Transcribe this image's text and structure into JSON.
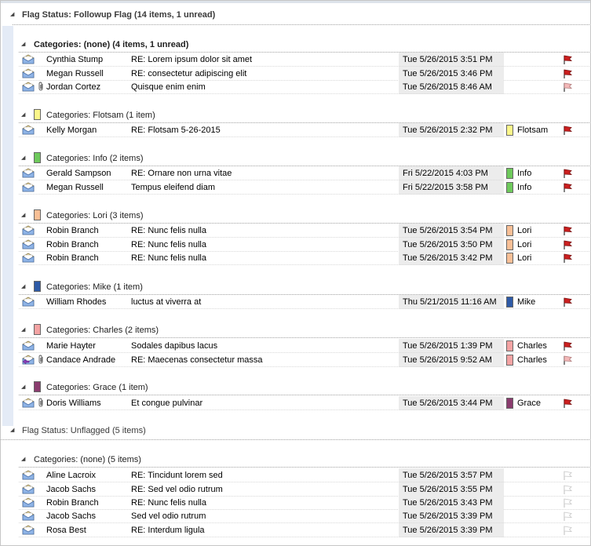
{
  "colors": {
    "Flotsam": "#fbf68a",
    "Info": "#6ec95c",
    "Lori": "#f8bf96",
    "Mike": "#2e5aa6",
    "Charles": "#f4a3a3",
    "Grace": "#8a3c6e",
    "flag_red": "#cc1f1f",
    "flag_pale": "#f3b8b8",
    "flag_empty": "#c7c7c7"
  },
  "groups": {
    "followup": {
      "label": "Flag Status: Followup Flag (14 items, 1 unread)"
    },
    "unflagged": {
      "label": "Flag Status: Unflagged (5 items)"
    }
  },
  "cat_headers": {
    "none1": "Categories: (none) (4 items, 1 unread)",
    "flotsam": "Categories: Flotsam (1 item)",
    "info": "Categories: Info (2 items)",
    "lori": "Categories: Lori (3 items)",
    "mike": "Categories: Mike (1 item)",
    "charles": "Categories: Charles (2 items)",
    "grace": "Categories: Grace (1 item)",
    "none2": "Categories: (none) (5 items)"
  },
  "messages": [
    {
      "from": "Cynthia Stump",
      "subject": "RE: Lorem ipsum dolor sit amet",
      "date": "Tue 5/26/2015 3:51 PM",
      "category": "",
      "unread": true,
      "attach": false,
      "icon": "open",
      "flag": "red"
    },
    {
      "from": "Megan Russell",
      "subject": "RE: consectetur adipiscing elit",
      "date": "Tue 5/26/2015 3:46 PM",
      "category": "",
      "unread": false,
      "attach": false,
      "icon": "open",
      "flag": "red"
    },
    {
      "from": "Jordan Cortez",
      "subject": "Quisque enim enim",
      "date": "Tue 5/26/2015 8:46 AM",
      "category": "",
      "unread": false,
      "attach": true,
      "icon": "open",
      "flag": "pale"
    },
    {
      "from": "Kelly Morgan",
      "subject": "RE: Flotsam 5-26-2015",
      "date": "Tue 5/26/2015 2:32 PM",
      "category": "Flotsam",
      "unread": false,
      "attach": false,
      "icon": "open",
      "flag": "red"
    },
    {
      "from": "Gerald Sampson",
      "subject": "RE: Ornare non urna vitae",
      "date": "Fri 5/22/2015 4:03 PM",
      "category": "Info",
      "unread": false,
      "attach": false,
      "icon": "open",
      "flag": "red"
    },
    {
      "from": "Megan Russell",
      "subject": "Tempus eleifend diam",
      "date": "Fri 5/22/2015 3:58 PM",
      "category": "Info",
      "unread": false,
      "attach": false,
      "icon": "open",
      "flag": "red"
    },
    {
      "from": "Robin Branch",
      "subject": "RE: Nunc felis nulla",
      "date": "Tue 5/26/2015 3:54 PM",
      "category": "Lori",
      "unread": false,
      "attach": false,
      "icon": "open",
      "flag": "red"
    },
    {
      "from": "Robin Branch",
      "subject": "RE: Nunc felis nulla",
      "date": "Tue 5/26/2015 3:50 PM",
      "category": "Lori",
      "unread": false,
      "attach": false,
      "icon": "open",
      "flag": "red"
    },
    {
      "from": "Robin Branch",
      "subject": "RE: Nunc felis nulla",
      "date": "Tue 5/26/2015 3:42 PM",
      "category": "Lori",
      "unread": false,
      "attach": false,
      "icon": "open",
      "flag": "red"
    },
    {
      "from": "William Rhodes",
      "subject": "luctus at viverra at",
      "date": "Thu 5/21/2015 11:16 AM",
      "category": "Mike",
      "unread": false,
      "attach": false,
      "icon": "open",
      "flag": "red"
    },
    {
      "from": "Marie Hayter",
      "subject": "Sodales dapibus lacus",
      "date": "Tue 5/26/2015 1:39 PM",
      "category": "Charles",
      "unread": false,
      "attach": false,
      "icon": "open",
      "flag": "red"
    },
    {
      "from": "Candace Andrade",
      "subject": "RE: Maecenas consectetur massa",
      "date": "Tue 5/26/2015 9:52 AM",
      "category": "Charles",
      "unread": false,
      "attach": true,
      "icon": "replied",
      "flag": "pale"
    },
    {
      "from": "Doris Williams",
      "subject": "Et congue pulvinar",
      "date": "Tue 5/26/2015 3:44 PM",
      "category": "Grace",
      "unread": false,
      "attach": true,
      "icon": "open",
      "flag": "red"
    },
    {
      "from": "Aline Lacroix",
      "subject": "RE: Tincidunt lorem sed",
      "date": "Tue 5/26/2015 3:57 PM",
      "category": "",
      "unread": false,
      "attach": false,
      "icon": "open",
      "flag": "empty"
    },
    {
      "from": "Jacob Sachs",
      "subject": "RE: Sed vel odio rutrum",
      "date": "Tue 5/26/2015 3:55 PM",
      "category": "",
      "unread": false,
      "attach": false,
      "icon": "open",
      "flag": "empty"
    },
    {
      "from": "Robin Branch",
      "subject": "RE: Nunc felis nulla",
      "date": "Tue 5/26/2015 3:43 PM",
      "category": "",
      "unread": false,
      "attach": false,
      "icon": "open",
      "flag": "empty"
    },
    {
      "from": "Jacob Sachs",
      "subject": "Sed vel odio rutrum",
      "date": "Tue 5/26/2015 3:39 PM",
      "category": "",
      "unread": false,
      "attach": false,
      "icon": "open",
      "flag": "empty"
    },
    {
      "from": "Rosa Best",
      "subject": "RE: Interdum ligula",
      "date": "Tue 5/26/2015 3:39 PM",
      "category": "",
      "unread": false,
      "attach": false,
      "icon": "open",
      "flag": "empty"
    }
  ]
}
